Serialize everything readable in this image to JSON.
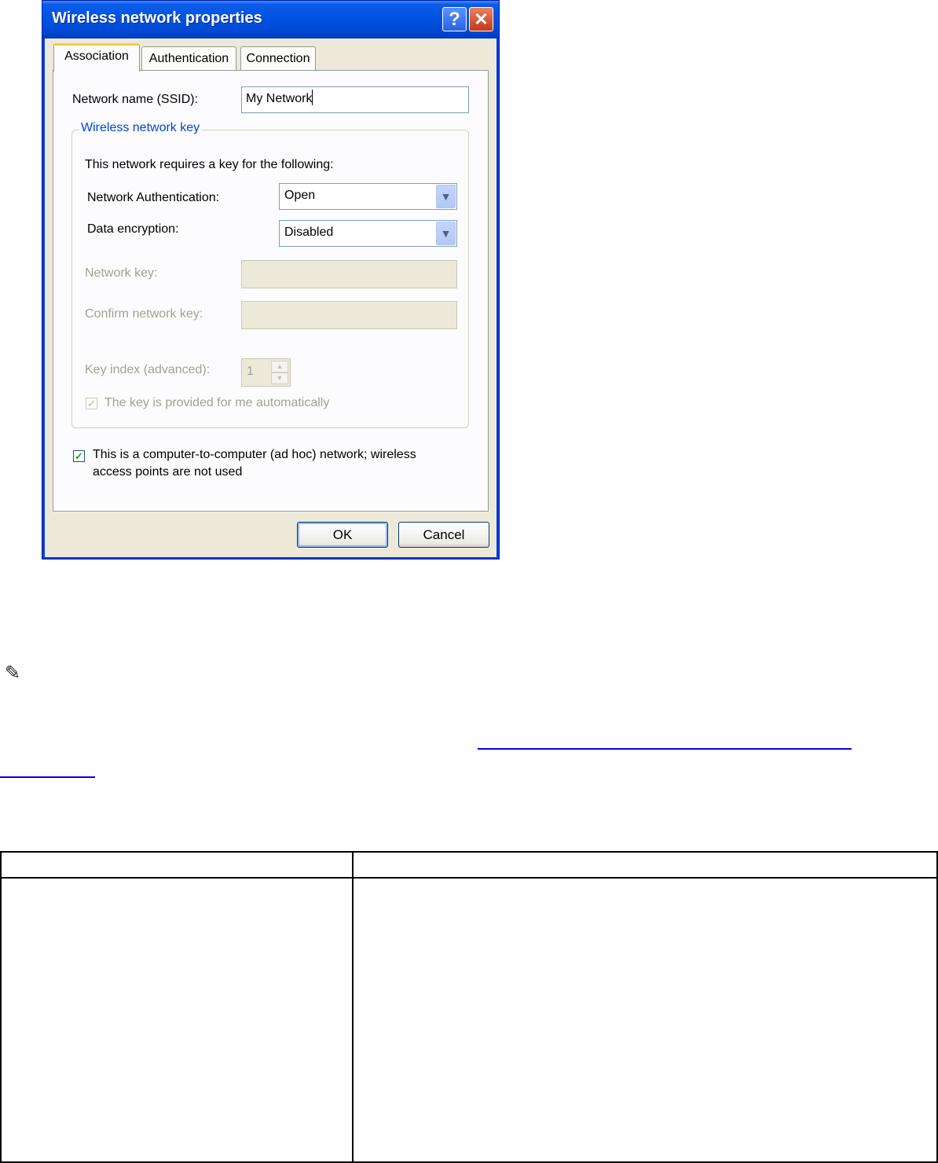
{
  "dialog": {
    "title": "Wireless network properties",
    "help_glyph": "?",
    "close_glyph": "✕",
    "tabs": [
      {
        "label": "Association",
        "active": true
      },
      {
        "label": "Authentication",
        "active": false
      },
      {
        "label": "Connection",
        "active": false
      }
    ],
    "ssid": {
      "label": "Network name (SSID):",
      "value": "My Network"
    },
    "group": {
      "legend": "Wireless network key",
      "intro": "This network requires a key for the following:",
      "auth": {
        "label": "Network Authentication:",
        "value": "Open"
      },
      "encryption": {
        "label": "Data encryption:",
        "value": "Disabled"
      },
      "network_key": {
        "label": "Network key:",
        "value": ""
      },
      "confirm_key": {
        "label": "Confirm network key:",
        "value": ""
      },
      "key_index": {
        "label": "Key index (advanced):",
        "value": "1"
      },
      "auto_key": {
        "label": "The key is provided for me automatically",
        "checked": true,
        "enabled": false
      }
    },
    "adhoc": {
      "line1": "This is a computer-to-computer (ad hoc) network; wireless",
      "line2": "access points are not used",
      "checked": true
    },
    "buttons": {
      "ok": "OK",
      "cancel": "Cancel"
    }
  },
  "page": {
    "note_icon": "pencil-note-icon"
  },
  "colors": {
    "title_bar": "#0054e3",
    "group_legend": "#0046d5",
    "check_mark": "#21a121",
    "link": "#0000ee"
  }
}
